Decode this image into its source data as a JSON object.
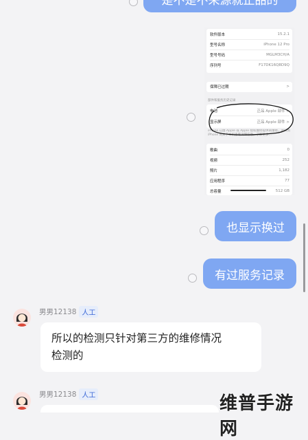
{
  "top_bubble": {
    "text": "是不是不来源就正品的"
  },
  "screenshot": {
    "specs": [
      {
        "k": "软件版本",
        "v": "15.2.1"
      },
      {
        "k": "型号名称",
        "v": "iPhone 12 Pro"
      },
      {
        "k": "型号号码",
        "v": "MGLM3CH/A"
      },
      {
        "k": "序列号",
        "v": "F17DK16Q8D9Q"
      }
    ],
    "warranty": {
      "k": "保障已过期",
      "v": ">"
    },
    "parts_header": "部件和服务历史记录",
    "parts": [
      {
        "k": "电池",
        "v": "正品 Apple 部件 >"
      },
      {
        "k": "显示屏",
        "v": "正品 Apple 部件 >"
      }
    ],
    "parts_note": "iPhone 已由 Apple 或 Apple 授权维修提供商维修，请转到 iPhone 的关于本机查看详细信息。了解更多...",
    "stats": [
      {
        "k": "歌曲",
        "v": "0"
      },
      {
        "k": "视频",
        "v": "252"
      },
      {
        "k": "照片",
        "v": "1,182"
      },
      {
        "k": "应用程序",
        "v": "77"
      },
      {
        "k": "总容量",
        "v": "512 GB"
      }
    ]
  },
  "bubble_display": {
    "text": "也显示换过"
  },
  "bubble_service": {
    "text": "有过服务记录"
  },
  "agent1": {
    "name": "男男12138",
    "tag": "人工",
    "line1": "所以的检测只针对第三方的维修情况",
    "line2": "检测的"
  },
  "agent2": {
    "name": "男男12138",
    "tag": "人工"
  },
  "watermark": {
    "text": "维普手游网"
  },
  "colors": {
    "user_bubble": "#7fa7f2",
    "tag_text": "#3a66d6",
    "background": "#f3f3f5"
  }
}
